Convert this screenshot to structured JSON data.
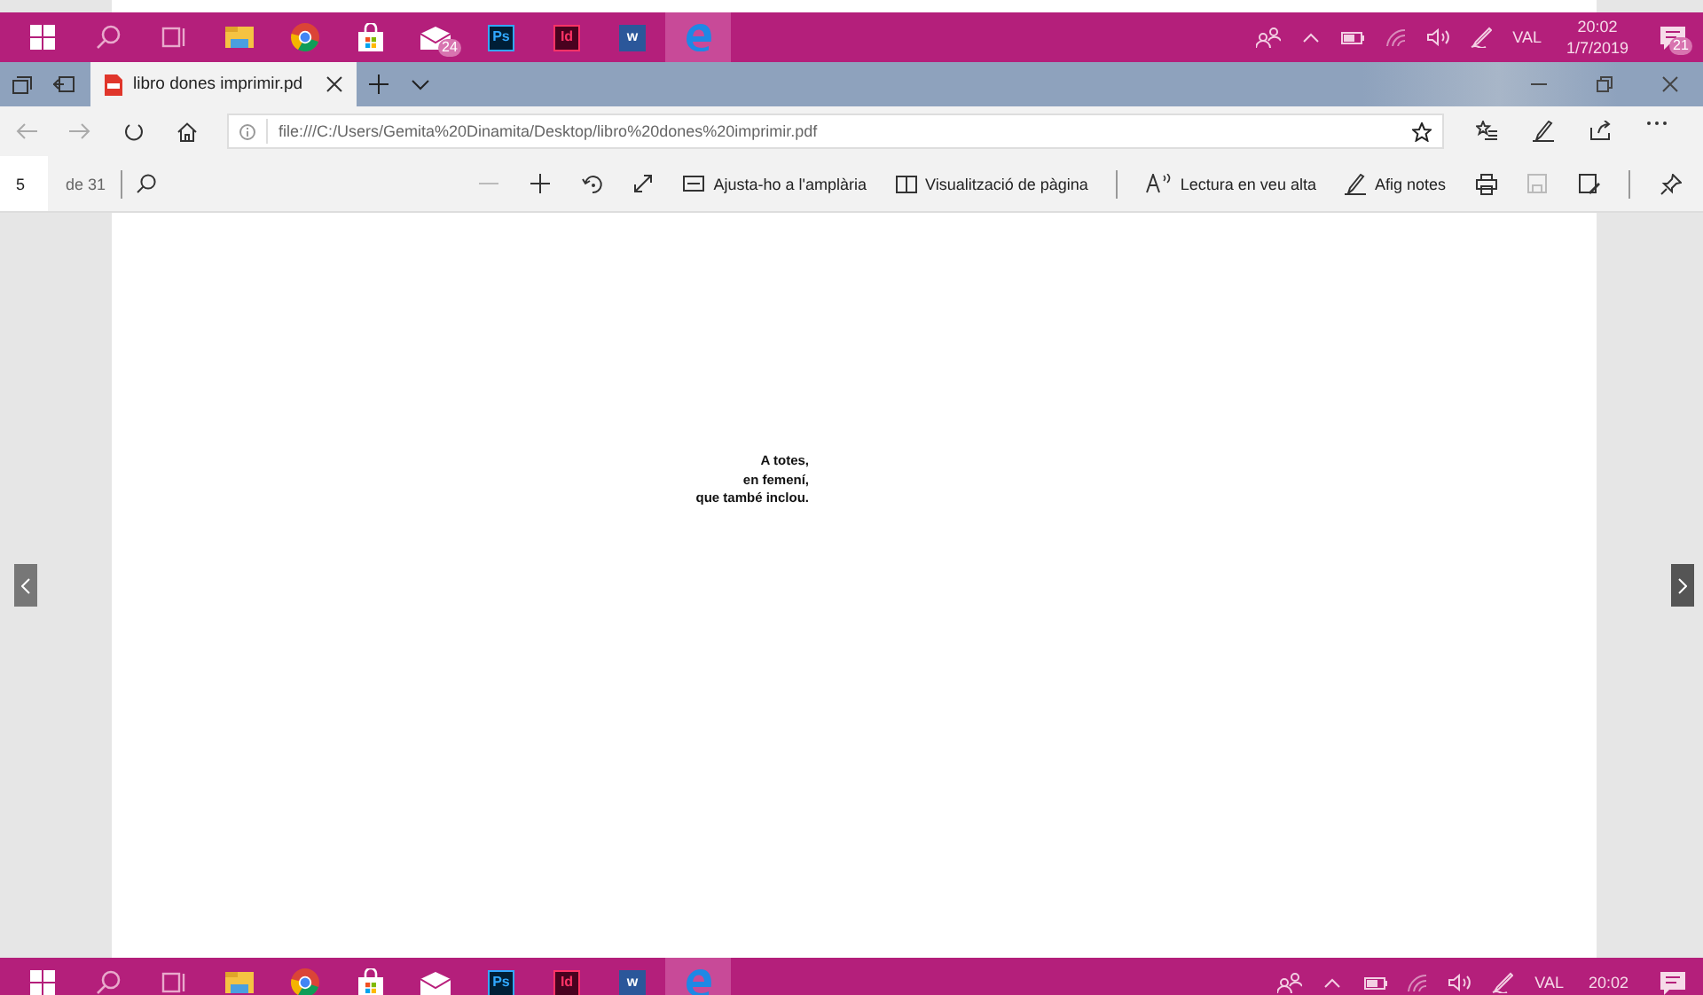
{
  "taskbars": [
    {
      "apps": [
        {
          "kind": "start",
          "active": false
        },
        {
          "kind": "search",
          "active": false
        },
        {
          "kind": "taskview",
          "active": false
        },
        {
          "kind": "folder",
          "active": false
        },
        {
          "kind": "chrome",
          "active": false
        },
        {
          "kind": "store",
          "active": false
        },
        {
          "kind": "mail",
          "active": false,
          "badge": "24"
        },
        {
          "kind": "ps",
          "active": false,
          "label": "Ps"
        },
        {
          "kind": "id",
          "active": false,
          "label": "Id"
        },
        {
          "kind": "word",
          "active": false,
          "label": "w"
        },
        {
          "kind": "edge",
          "active": true
        }
      ],
      "language": "VAL",
      "time": "20:02",
      "date": "1/7/2019",
      "notifications": "21"
    },
    {
      "apps": [
        {
          "kind": "start",
          "active": false
        },
        {
          "kind": "search",
          "active": false
        },
        {
          "kind": "taskview",
          "active": false
        },
        {
          "kind": "folder",
          "active": false
        },
        {
          "kind": "chrome",
          "active": false
        },
        {
          "kind": "store",
          "active": false
        },
        {
          "kind": "mail",
          "active": false
        },
        {
          "kind": "ps",
          "active": false,
          "label": "Ps"
        },
        {
          "kind": "id",
          "active": false,
          "label": "Id"
        },
        {
          "kind": "word",
          "active": false,
          "label": "w"
        },
        {
          "kind": "edge",
          "active": true
        }
      ],
      "language": "VAL",
      "time": "20:02"
    }
  ],
  "browser": {
    "tabs": [
      {
        "title": "libro dones imprimir.pd",
        "selected": true
      }
    ],
    "address": "file:///C:/Users/Gemita%20Dinamita/Desktop/libro%20dones%20imprimir.pdf"
  },
  "pdf_toolbar": {
    "page": "5",
    "page_count": "de 31",
    "tools": [
      {
        "kind": "zoom-out",
        "disabled": true
      },
      {
        "kind": "zoom-in",
        "disabled": false
      },
      {
        "kind": "rotate",
        "disabled": false
      },
      {
        "kind": "fullscreen",
        "disabled": false
      },
      {
        "kind": "fit",
        "label": "Ajusta-ho a l'amplària",
        "disabled": false
      },
      {
        "kind": "layout",
        "label": "Visualització de pàgina",
        "disabled": false
      },
      {
        "kind": "sep"
      },
      {
        "kind": "read",
        "label": "Lectura en veu alta",
        "disabled": false
      },
      {
        "kind": "notes",
        "label": "Afig notes",
        "disabled": false
      },
      {
        "kind": "print",
        "disabled": false
      },
      {
        "kind": "save",
        "disabled": true
      },
      {
        "kind": "saveas",
        "disabled": false
      },
      {
        "kind": "sep"
      },
      {
        "kind": "pin",
        "disabled": false
      }
    ]
  },
  "document": {
    "lines": [
      "A totes,",
      "en femení,",
      "que també inclou."
    ]
  }
}
